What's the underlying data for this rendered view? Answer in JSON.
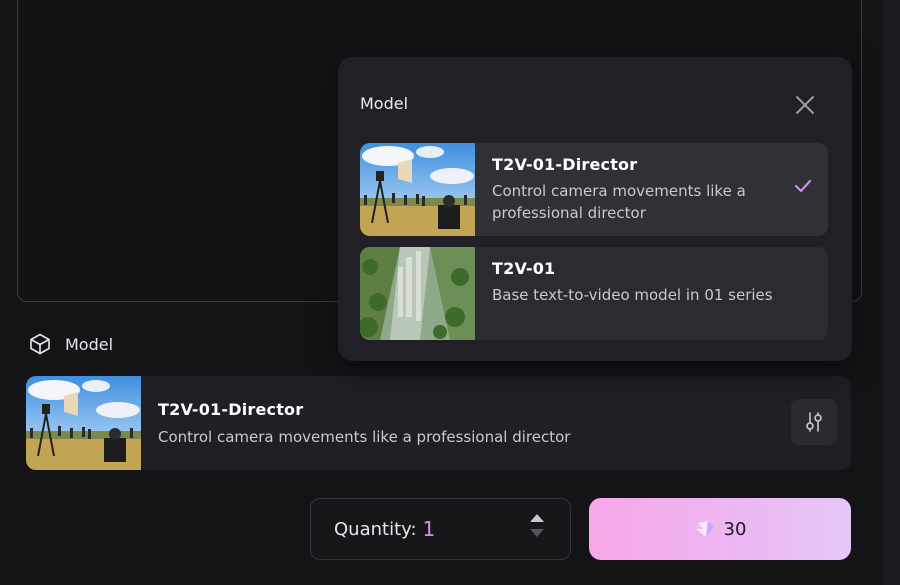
{
  "popup": {
    "title": "Model",
    "options": [
      {
        "name": "T2V-01-Director",
        "description": "Control camera movements like a professional director",
        "selected": true
      },
      {
        "name": "T2V-01",
        "description": "Base text-to-video model in 01 series",
        "selected": false
      }
    ]
  },
  "model_section": {
    "label": "Model",
    "selected": {
      "name": "T2V-01-Director",
      "description": "Control camera movements like a professional director"
    }
  },
  "quantity": {
    "label": "Quantity:",
    "value": "1"
  },
  "generate": {
    "credits": "30"
  },
  "colors": {
    "accent": "#d38cf0",
    "generate_gradient_start": "#f7a7e9",
    "generate_gradient_end": "#e6c8f7",
    "background": "#141417"
  },
  "icons": [
    "cube-icon",
    "close-icon",
    "check-icon",
    "settings-sliders-icon",
    "chevron-up-icon",
    "chevron-down-icon",
    "credit-gem-icon"
  ]
}
